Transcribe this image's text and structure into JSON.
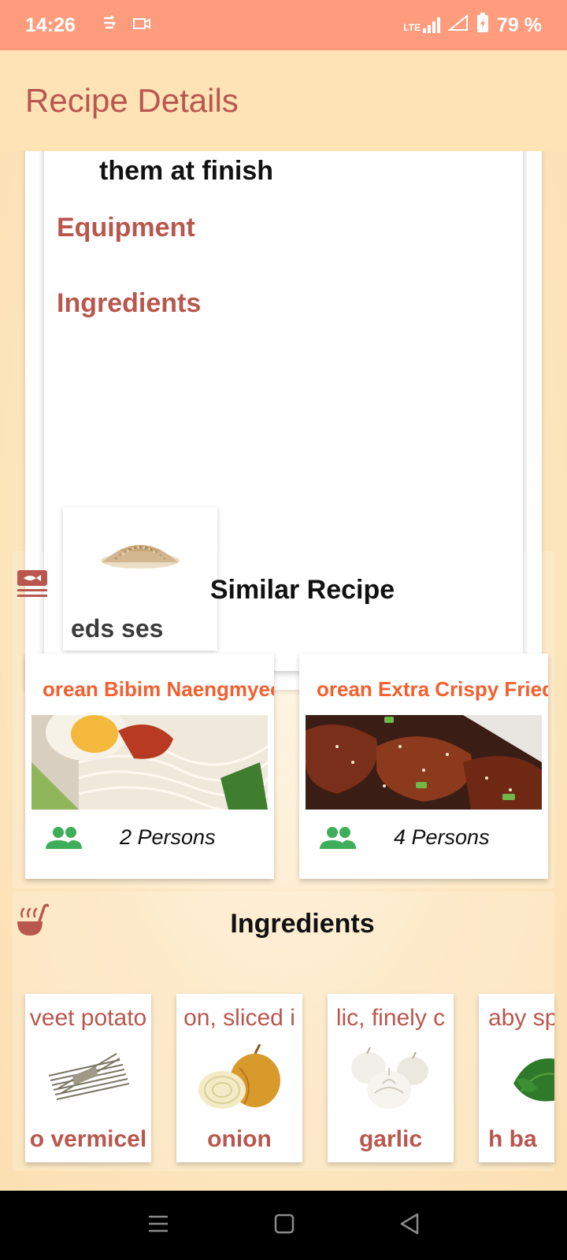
{
  "status": {
    "time": "14:26",
    "network": "LTE",
    "battery": "79 %"
  },
  "app_bar": {
    "title": "Recipe Details"
  },
  "details": {
    "step_text": "them at finish",
    "equipment_label": "Equipment",
    "ingredients_label": "Ingredients",
    "ingredient_item": "eds      ses"
  },
  "similar": {
    "title": "Similar Recipe",
    "recipes": [
      {
        "title": "orean Bibim Naengmyeon",
        "persons": "2 Persons"
      },
      {
        "title": "orean Extra Crispy Fried",
        "persons": "4 Persons"
      }
    ]
  },
  "ingredients": {
    "title": "Ingredients",
    "items": [
      {
        "top": "veet potato",
        "bottom": "o vermicel"
      },
      {
        "top": "on, sliced i",
        "bottom": "onion"
      },
      {
        "top": "lic, finely c",
        "bottom": "garlic"
      },
      {
        "top": "aby sp",
        "bottom": "h      ba"
      }
    ]
  },
  "colors": {
    "status_bar": "#ff9c7d",
    "background": "#fde3b6",
    "accent": "#b9574e",
    "recipe_title": "#f35f2e",
    "persons_icon": "#3fae5a"
  }
}
